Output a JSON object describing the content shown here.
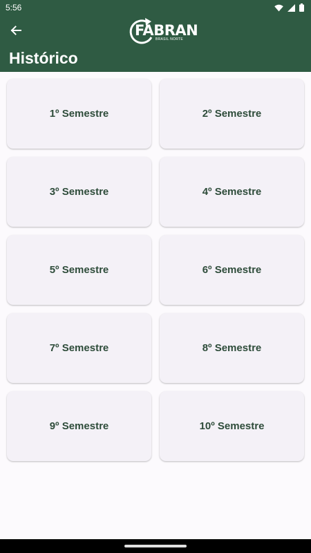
{
  "status_bar": {
    "time": "5:56",
    "icons": [
      "wifi-icon",
      "signal-icon",
      "battery-icon"
    ]
  },
  "app_bar": {
    "back_icon": "arrow-left-icon",
    "logo_text": "FABRAN",
    "logo_subtext": "BRASIL NORTE",
    "title": "Histórico"
  },
  "semesters": [
    {
      "label": "1º Semestre"
    },
    {
      "label": "2º Semestre"
    },
    {
      "label": "3º Semestre"
    },
    {
      "label": "4º Semestre"
    },
    {
      "label": "5º Semestre"
    },
    {
      "label": "6º Semestre"
    },
    {
      "label": "7º Semestre"
    },
    {
      "label": "8º Semestre"
    },
    {
      "label": "9º Semestre"
    },
    {
      "label": "10º Semestre"
    }
  ],
  "colors": {
    "primary": "#2f5b43",
    "card_background": "#f4f1f7",
    "card_text": "#2e4c3a",
    "page_background": "#fcfafd"
  }
}
